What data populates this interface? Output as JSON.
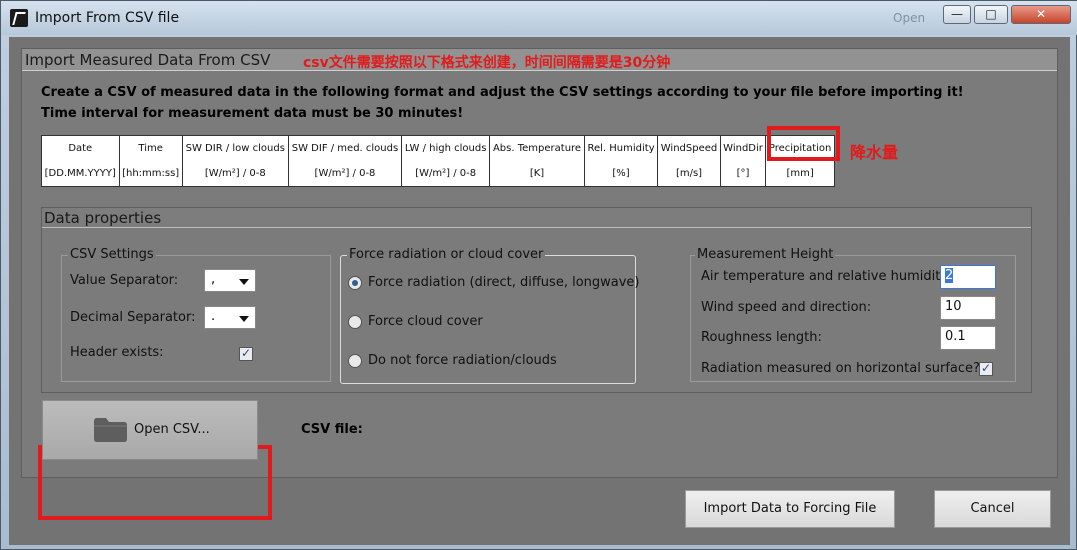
{
  "window": {
    "title": "Import From CSV file",
    "background_hint": "Open",
    "min_glyph": "—",
    "max_glyph": "□",
    "close_glyph": "✕"
  },
  "main": {
    "title": "Import Measured Data From CSV",
    "cn_note": "csv文件需要按照以下格式来创建，时间间隔需要是30分钟",
    "instruction_1": "Create a CSV of measured data in the following format and adjust the CSV settings according to your file before importing it!",
    "instruction_2": "Time interval for measurement data must be 30 minutes!",
    "precip_cn": "降水量"
  },
  "format_table": {
    "headers": [
      "Date",
      "Time",
      "SW DIR / low clouds",
      "SW DIF / med. clouds",
      "LW / high clouds",
      "Abs. Temperature",
      "Rel. Humidity",
      "WindSpeed",
      "WindDir",
      "Precipitation"
    ],
    "units": [
      "[DD.MM.YYYY]",
      "[hh:mm:ss]",
      "[W/m²] / 0-8",
      "[W/m²] / 0-8",
      "[W/m²] / 0-8",
      "[K]",
      "[%]",
      "[m/s]",
      "[°]",
      "[mm]"
    ]
  },
  "data_properties": {
    "title": "Data properties",
    "csv_settings": {
      "title": "CSV Settings",
      "value_sep_label": "Value Separator:",
      "value_sep_value": ",",
      "decimal_sep_label": "Decimal Separator:",
      "decimal_sep_value": ".",
      "header_label": "Header exists:"
    },
    "force": {
      "title": "Force radiation or cloud cover",
      "opt1": "Force radiation (direct, diffuse, longwave)",
      "opt2": "Force cloud cover",
      "opt3": "Do not force radiation/clouds"
    },
    "height": {
      "title": "Measurement Height",
      "air_label": "Air temperature and relative humidity:",
      "air_value": "2",
      "wind_label": "Wind speed and direction:",
      "wind_value": "10",
      "rough_label": "Roughness length:",
      "rough_value": "0.1",
      "rad_label": "Radiation measured on horizontal surface?"
    }
  },
  "actions": {
    "open_csv": "Open CSV...",
    "csv_file_label": "CSV file:",
    "import_label": "Import Data to Forcing File",
    "cancel_label": "Cancel"
  }
}
